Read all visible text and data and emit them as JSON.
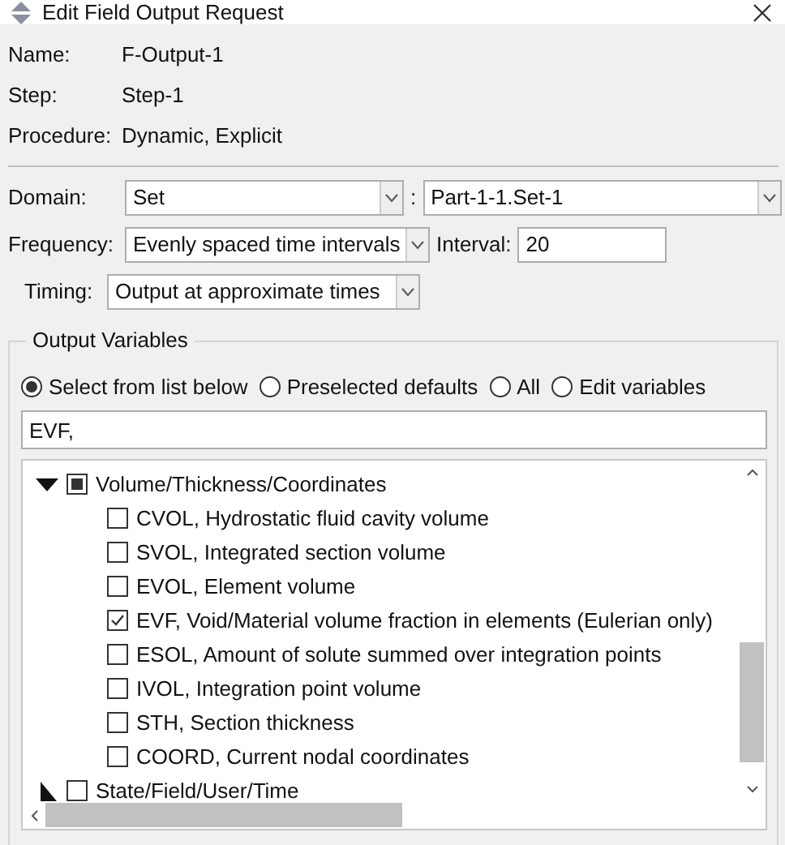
{
  "window": {
    "title": "Edit Field Output Request"
  },
  "info": [
    {
      "label": "Name:",
      "value": "F-Output-1"
    },
    {
      "label": "Step:",
      "value": "Step-1"
    },
    {
      "label": "Procedure:",
      "value": "Dynamic, Explicit"
    }
  ],
  "domain": {
    "label": "Domain:",
    "value": "Set",
    "separator": ":",
    "set_value": "Part-1-1.Set-1"
  },
  "frequency": {
    "label": "Frequency:",
    "value": "Evenly spaced time intervals",
    "interval_label": "Interval:",
    "interval_value": "20"
  },
  "timing": {
    "label": "Timing:",
    "value": "Output at approximate times"
  },
  "output_variables": {
    "title": "Output Variables",
    "options": [
      {
        "label": "Select from list below",
        "selected": true
      },
      {
        "label": "Preselected defaults",
        "selected": false
      },
      {
        "label": "All",
        "selected": false
      },
      {
        "label": "Edit variables",
        "selected": false
      }
    ],
    "text": "EVF,",
    "tree": [
      {
        "label": "Volume/Thickness/Coordinates",
        "expanded": true,
        "checked": false,
        "partial": true,
        "children": [
          {
            "label": "CVOL, Hydrostatic fluid cavity volume",
            "checked": false
          },
          {
            "label": "SVOL, Integrated section volume",
            "checked": false
          },
          {
            "label": "EVOL, Element volume",
            "checked": false
          },
          {
            "label": "EVF, Void/Material volume fraction in elements (Eulerian only)",
            "checked": true
          },
          {
            "label": "ESOL, Amount of solute summed over integration points",
            "checked": false
          },
          {
            "label": "IVOL, Integration point volume",
            "checked": false
          },
          {
            "label": "STH, Section thickness",
            "checked": false
          },
          {
            "label": "COORD, Current nodal coordinates",
            "checked": false
          }
        ]
      },
      {
        "label": "State/Field/User/Time",
        "expanded": false,
        "checked": false,
        "partial": false
      }
    ]
  }
}
